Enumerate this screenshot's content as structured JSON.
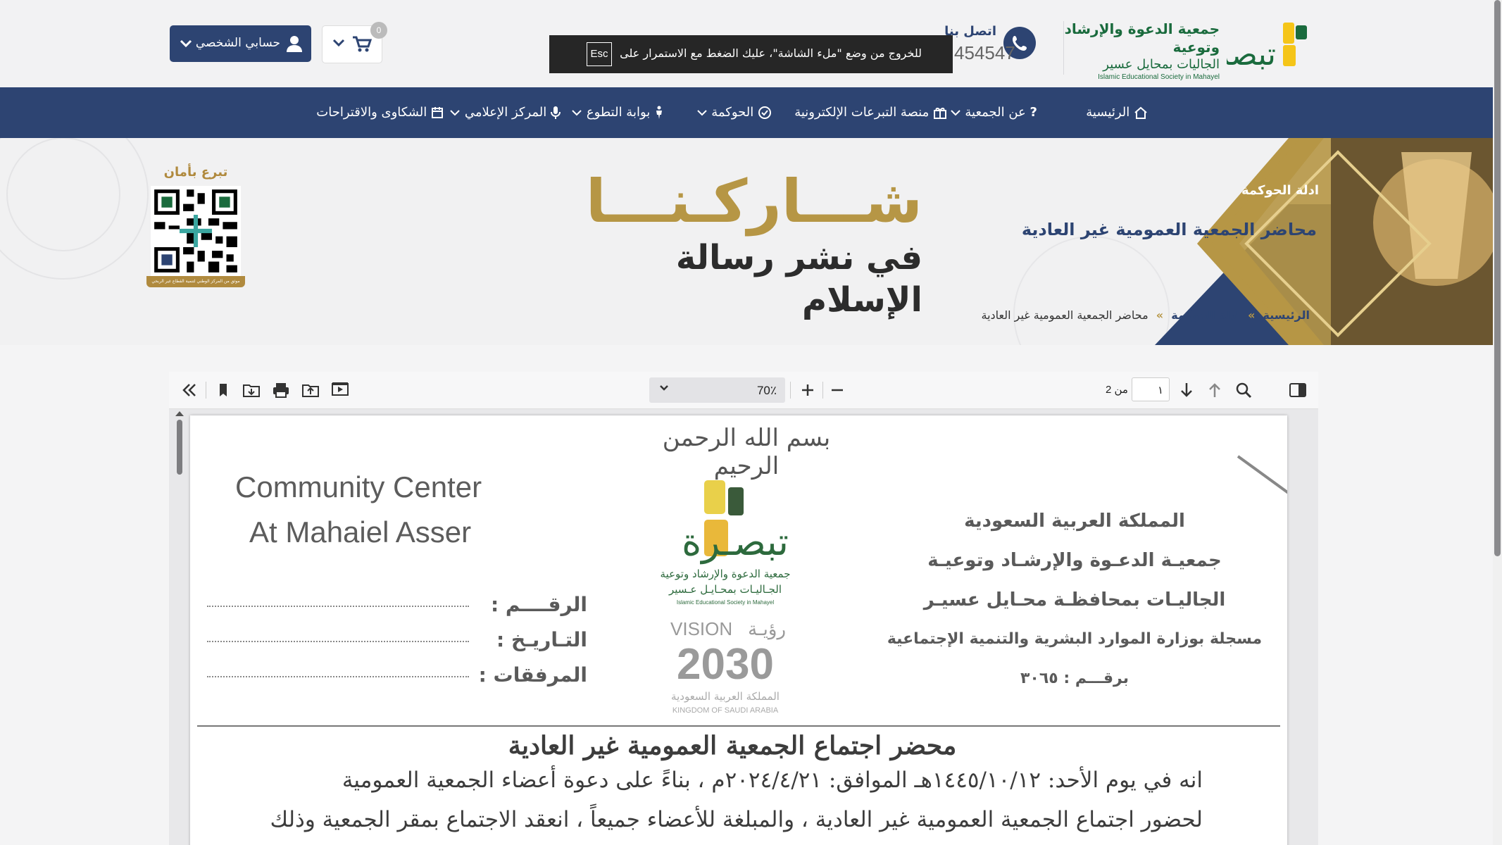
{
  "header": {
    "logo": {
      "name_ar": "تبصرة",
      "line1": "جمعية الدعوة والإرشاد وتوعية",
      "line2": "الجاليات بمحايل عسير",
      "line3": "Islamic Educational Society in Mahayel"
    },
    "contact": {
      "label": "اتصل بنا",
      "number": "454547"
    },
    "fullscreen_toast": {
      "message": "للخروج من وضع \"ملء الشاشة\"، عليك الضغط مع الاستمرار على",
      "key": "Esc"
    },
    "cart": {
      "count": "0"
    },
    "account": {
      "label": "حسابي الشخصي"
    }
  },
  "nav": {
    "items": [
      {
        "label": "الرئيسية",
        "icon": "home-icon"
      },
      {
        "label": "عن الجمعية",
        "icon": "question-icon",
        "dropdown": true
      },
      {
        "label": "منصة التبرعات الإلكترونية",
        "icon": "gift-icon"
      },
      {
        "label": "الحوكمة",
        "icon": "check-circle-icon",
        "dropdown": true
      },
      {
        "label": "بوابة التطوع",
        "icon": "person-icon",
        "dropdown": true
      },
      {
        "label": "المركز الإعلامي",
        "icon": "microphone-icon",
        "dropdown": true
      },
      {
        "label": "الشكاوى والاقتراحات",
        "icon": "calendar-icon"
      }
    ]
  },
  "hero": {
    "qr_title": "تبرع بأمان",
    "qr_footer": "موثق من المركز الوطني لتنمية القطاع غير الربحي",
    "headline": "شـــاركـنـــا",
    "subheadline": "في نشر رسالة الإسلام",
    "section_label": "ادلة الحوكمة",
    "page_title": "محاضر الجمعية العمومية غير العادية",
    "breadcrumb": {
      "home": "الرئيسية",
      "parent": "ادلة الحوكمة",
      "current": "محاضر الجمعية العمومية غير العادية",
      "separator": "»"
    }
  },
  "pdf_viewer": {
    "zoom": "70٪",
    "page_current": "١",
    "page_total_label": "من 2",
    "document": {
      "basmala": "بسم الله الرحمن الرحيم",
      "en_line1": "Community Center",
      "en_line2": "At Mahaiel  Asser",
      "ar_lines": [
        "المملكة العربية السعودية",
        "جمعيـة الدعـوة والإرشـاد وتوعيـة",
        "الجاليـات بمحافظـة محـايل عسيـر",
        "مسجلة بوزارة الموارد البشرية والتنمية الإجتماعية",
        "برقـــم : ٣٠٦٥"
      ],
      "fields": [
        "الرقــــم :",
        "التـاريـخ :",
        "المرفقات :"
      ],
      "logo_name": "تبصـرة",
      "logo_l1": "جمعية الدعوة والإرشاد وتوعية",
      "logo_l2": "الجـاليـات بمحـايـل عـسير",
      "logo_l3": "Islamic Educational Society in Mahayel",
      "vision_en": "VISION",
      "vision_ar": "رؤيـة",
      "vision_year": "2030",
      "vision_kingdom_ar": "المملكة العربية السعودية",
      "vision_kingdom_en": "KINGDOM OF SAUDI ARABIA",
      "title": "محضر اجتماع الجمعية العمومية غير العادية",
      "body": [
        "انه في يوم الأحد: ١٤٤٥/١٠/١٢هـ الموافق: ٢٠٢٤/٤/٢١م ، بناءً على دعوة أعضاء الجمعية العمومية",
        "لحضور اجتماع الجمعية العمومية غير العادية ، والمبلغة للأعضاء جميعاً ، انعقد الاجتماع بمقر الجمعية وذلك"
      ]
    }
  },
  "colors": {
    "primary": "#2d4472",
    "gold": "#b69645",
    "green": "#1a6b3d",
    "yellow": "#f5c518"
  }
}
